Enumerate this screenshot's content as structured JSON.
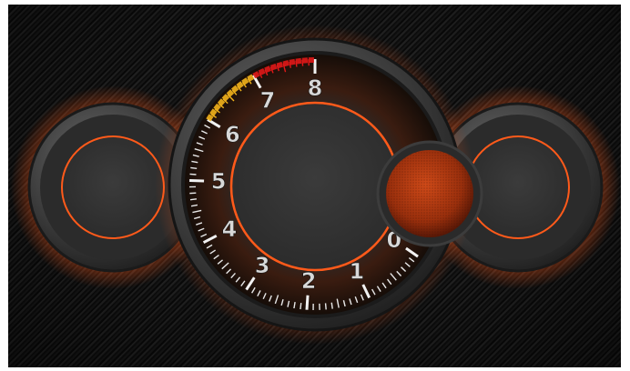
{
  "tachometer": {
    "scale_labels": [
      "0",
      "1",
      "2",
      "3",
      "4",
      "5",
      "6",
      "7",
      "8"
    ],
    "accent_color": "#ff5a1a",
    "redline_color": "#e01818",
    "warning_color": "#f2b21c"
  },
  "side_gauges": {
    "count": 2
  }
}
